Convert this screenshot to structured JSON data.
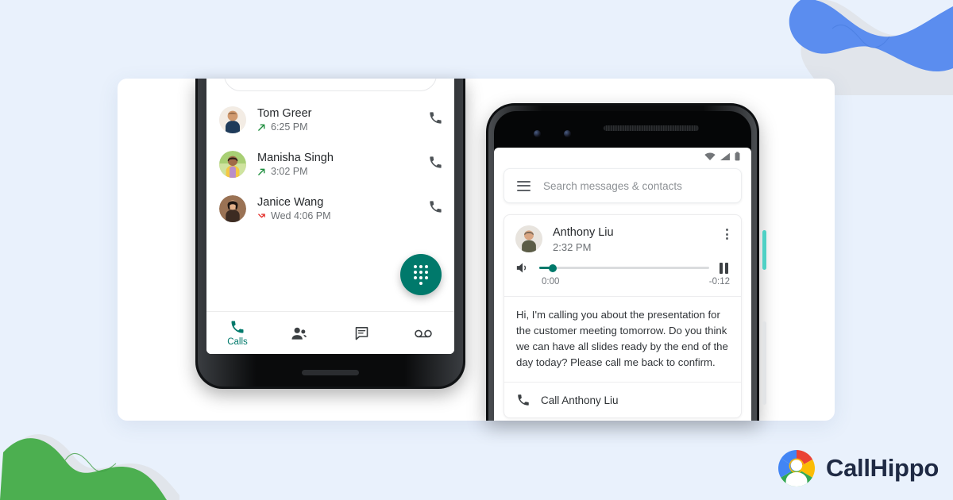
{
  "theme": {
    "page_bg": "#e9f1fc",
    "card_bg": "#ffffff",
    "accent_teal": "#00796b",
    "blob_blue": "#5b8def",
    "blob_green": "#4caf50",
    "blob_shadow": "#dfe3e8",
    "logo_text_color": "#1f2a44",
    "missed_red": "#e53935",
    "outgoing_green": "#1e8e3e"
  },
  "left_phone": {
    "name": "phone-dialer",
    "search_bar": {
      "visible_partial": true
    },
    "call_list": [
      {
        "name": "Tom Greer",
        "time": "6:25 PM",
        "direction_icon": "outgoing-call-arrow-icon",
        "direction": "outgoing",
        "action_icon": "phone-icon",
        "avatar_colors": [
          "#f0e3d4",
          "#c98f62",
          "#1f3b5a"
        ]
      },
      {
        "name": "Manisha Singh",
        "time": "3:02 PM",
        "direction_icon": "outgoing-call-arrow-icon",
        "direction": "outgoing",
        "action_icon": "phone-icon",
        "avatar_colors": [
          "#bfe08a",
          "#f2c744",
          "#8d5a42"
        ]
      },
      {
        "name": "Janice Wang",
        "time": "Wed 4:06 PM",
        "direction_icon": "missed-call-arrow-icon",
        "direction": "missed",
        "action_icon": "phone-icon",
        "avatar_colors": [
          "#8c6a52",
          "#3a2a20",
          "#e8c3a0"
        ]
      }
    ],
    "fab": {
      "icon": "dialpad-icon",
      "color": "#00796b"
    },
    "bottom_nav": [
      {
        "icon": "phone-icon",
        "label": "Calls",
        "active": true
      },
      {
        "icon": "contacts-icon",
        "label": "",
        "active": false
      },
      {
        "icon": "messages-icon",
        "label": "",
        "active": false
      },
      {
        "icon": "voicemail-icon",
        "label": "",
        "active": false
      }
    ]
  },
  "right_phone": {
    "name": "phone-voicemail",
    "status_bar": {
      "icons": [
        "wifi-icon",
        "signal-icon",
        "battery-icon"
      ]
    },
    "search": {
      "menu_icon": "hamburger-menu-icon",
      "placeholder": "Search messages & contacts"
    },
    "voicemail_card": {
      "contact_name": "Anthony Liu",
      "timestamp": "2:32 PM",
      "overflow_icon": "kebab-menu-icon",
      "player": {
        "speaker_icon": "speaker-icon",
        "pause_icon": "pause-icon",
        "elapsed": "0:00",
        "remaining": "-0:12",
        "progress_percent": 8
      },
      "transcript": "Hi, I'm calling you about the presentation for the customer meeting tomorrow. Do you think we can have all slides ready by the end of the day today? Please call me back to confirm.",
      "callback": {
        "icon": "phone-icon",
        "label": "Call Anthony Liu"
      }
    }
  },
  "branding": {
    "logo_icon": "callhippo-logo-icon",
    "name": "CallHippo"
  }
}
